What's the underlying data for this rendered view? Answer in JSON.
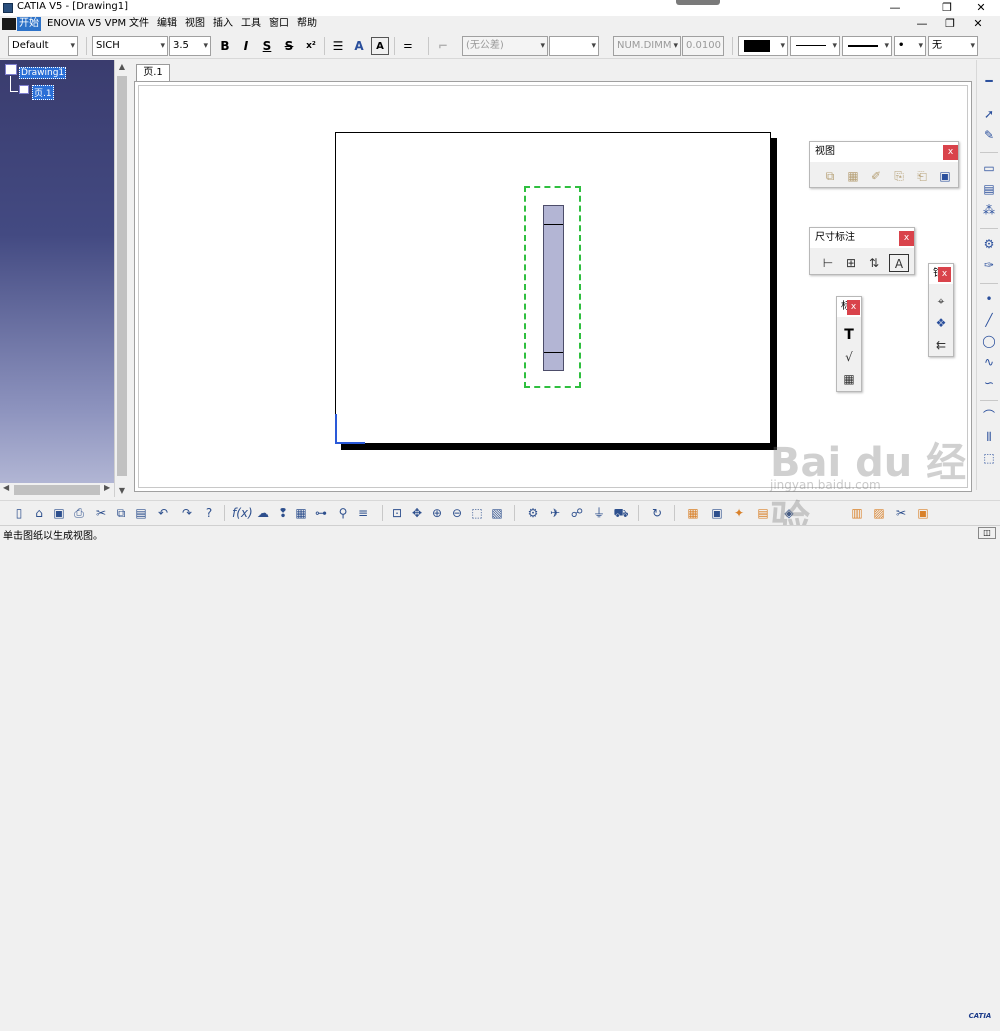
{
  "window": {
    "title": "CATIA V5 - [Drawing1]",
    "controls": [
      "—",
      "❐",
      "✕"
    ]
  },
  "menu": {
    "items": [
      "开始",
      "ENOVIA V5 VPM",
      "文件",
      "编辑",
      "视图",
      "插入",
      "工具",
      "窗口",
      "帮助"
    ],
    "doc_controls": [
      "—",
      "❐",
      "✕"
    ]
  },
  "toolbar": {
    "style": "Default",
    "font": "SICH",
    "font_size": "3.5",
    "bold": "B",
    "italic": "I",
    "underline": "S",
    "strike": "S",
    "superscript": "x²",
    "tolerance": "(无公差)",
    "tolerance2": "",
    "dim_format": "NUM.DIMM",
    "precision": "0.0100",
    "line_weight_value": "无"
  },
  "tree": {
    "root": "Drawing1",
    "child": "页.1"
  },
  "sheet_tab": "页.1",
  "panels": {
    "view_title": "视图",
    "dimension_title": "尺寸标注",
    "close": "x",
    "geometry_title": "钳",
    "text_title": "标"
  },
  "status": {
    "message": "单击图纸以生成视图。"
  },
  "watermark": {
    "main": "Bai du 经验",
    "sub": "jingyan.baidu.com"
  },
  "brand": "CATIA"
}
